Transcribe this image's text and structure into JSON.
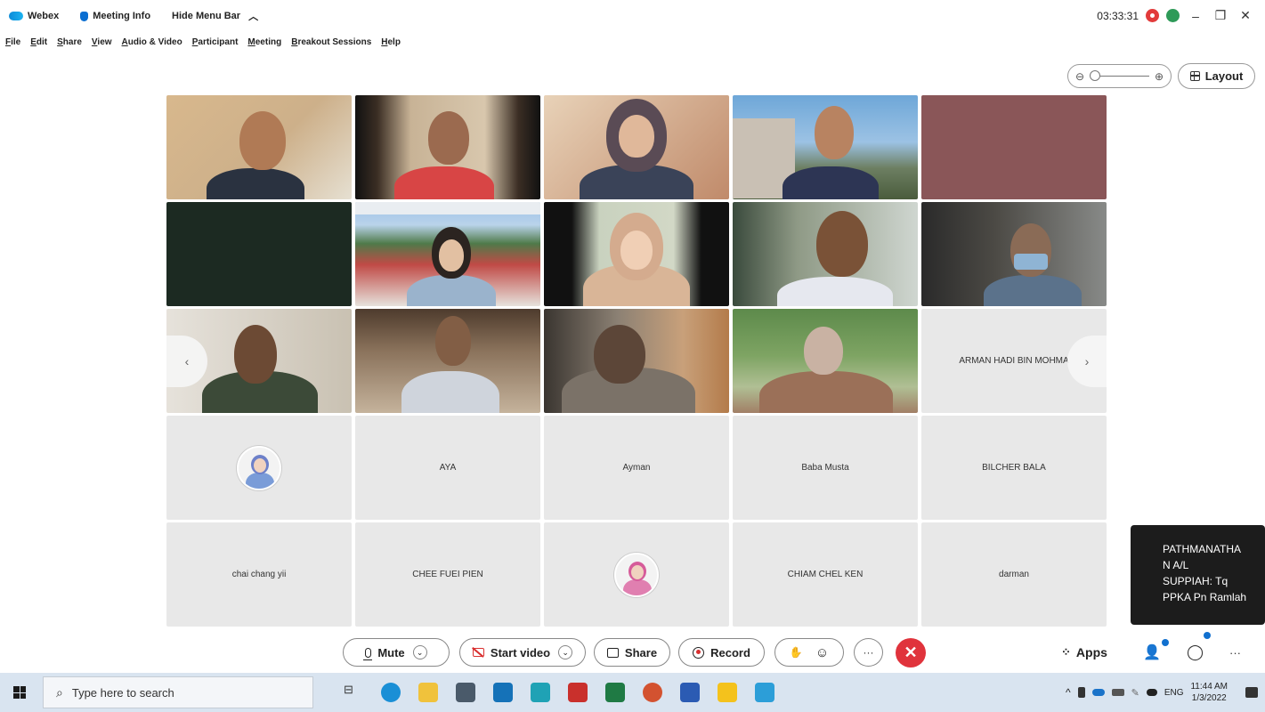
{
  "titlebar": {
    "app_name": "Webex",
    "meeting_info": "Meeting Info",
    "hide_menu_bar": "Hide Menu Bar",
    "hide_menu_chevron": "︿",
    "time": "03:33:31",
    "minimize": "–",
    "restore": "❐",
    "close": "✕"
  },
  "menu": [
    "File",
    "Edit",
    "Share",
    "View",
    "Audio & Video",
    "Participant",
    "Meeting",
    "Breakout Sessions",
    "Help"
  ],
  "zoom": {
    "minus": "⊖",
    "plus": "⊕",
    "level": 0.0
  },
  "layout_button": "Layout",
  "grid": {
    "tiles": [
      {
        "type": "video",
        "label": ""
      },
      {
        "type": "video",
        "label": ""
      },
      {
        "type": "video",
        "label": ""
      },
      {
        "type": "video",
        "label": ""
      },
      {
        "type": "video",
        "label": ""
      },
      {
        "type": "video",
        "label": ""
      },
      {
        "type": "video",
        "label": ""
      },
      {
        "type": "video",
        "label": ""
      },
      {
        "type": "video",
        "label": ""
      },
      {
        "type": "video",
        "label": ""
      },
      {
        "type": "video",
        "label": ""
      },
      {
        "type": "video",
        "label": ""
      },
      {
        "type": "video",
        "label": ""
      },
      {
        "type": "video",
        "label": ""
      },
      {
        "type": "name",
        "label": "ARMAN HADI BIN MOHMA"
      },
      {
        "type": "avatar",
        "label": ""
      },
      {
        "type": "name",
        "label": "AYA"
      },
      {
        "type": "name",
        "label": "Ayman"
      },
      {
        "type": "name",
        "label": "Baba Musta"
      },
      {
        "type": "name",
        "label": "BILCHER BALA"
      },
      {
        "type": "name",
        "label": "chai chang yii"
      },
      {
        "type": "name",
        "label": "CHEE FUEI PIEN"
      },
      {
        "type": "avatar",
        "label": ""
      },
      {
        "type": "name",
        "label": "CHIAM CHEL KEN"
      },
      {
        "type": "name",
        "label": "darman"
      }
    ],
    "prev": "‹",
    "next": "›"
  },
  "chat_tooltip": [
    "PATHMANATHA",
    "N A/L",
    "SUPPIAH: Tq",
    "PPKA Pn Ramlah"
  ],
  "controls": {
    "mute": "Mute",
    "start_video": "Start video",
    "share": "Share",
    "record": "Record",
    "raise_hand": "✋",
    "reactions": "☺",
    "more": "···",
    "end": "✕",
    "apps": "Apps",
    "participants": "👤",
    "chat": "◯",
    "overflow": "···",
    "caret": "⌄"
  },
  "taskbar": {
    "search_placeholder": "Type here to search",
    "tray_chevron": "^",
    "language": "ENG",
    "time": "11:44 AM",
    "date": "1/3/2022"
  },
  "colors": {
    "end_button": "#e0333c",
    "recording": "#e23b3b",
    "accent_blue": "#1170cf"
  }
}
